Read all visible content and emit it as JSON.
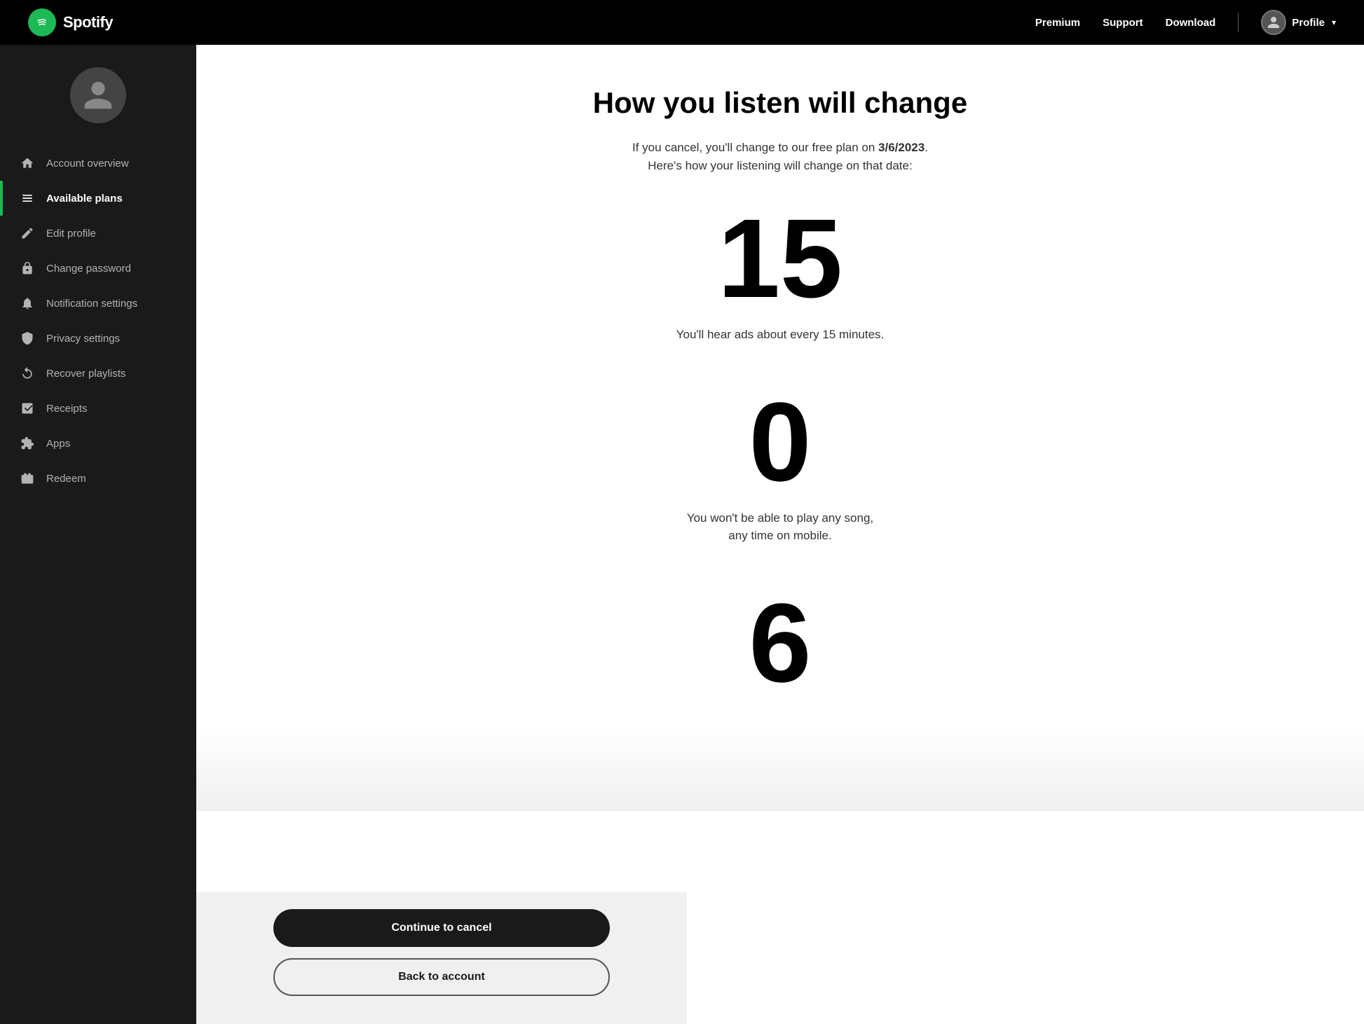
{
  "header": {
    "logo_text": "Spotify",
    "nav_items": [
      {
        "label": "Premium",
        "id": "premium"
      },
      {
        "label": "Support",
        "id": "support"
      },
      {
        "label": "Download",
        "id": "download"
      }
    ],
    "profile_label": "Profile"
  },
  "sidebar": {
    "items": [
      {
        "id": "account-overview",
        "label": "Account overview",
        "icon": "home-icon",
        "active": false
      },
      {
        "id": "available-plans",
        "label": "Available plans",
        "icon": "plans-icon",
        "active": true
      },
      {
        "id": "edit-profile",
        "label": "Edit profile",
        "icon": "edit-icon",
        "active": false
      },
      {
        "id": "change-password",
        "label": "Change password",
        "icon": "lock-icon",
        "active": false
      },
      {
        "id": "notification-settings",
        "label": "Notification settings",
        "icon": "bell-icon",
        "active": false
      },
      {
        "id": "privacy-settings",
        "label": "Privacy settings",
        "icon": "privacy-icon",
        "active": false
      },
      {
        "id": "recover-playlists",
        "label": "Recover playlists",
        "icon": "recover-icon",
        "active": false
      },
      {
        "id": "receipts",
        "label": "Receipts",
        "icon": "receipts-icon",
        "active": false
      },
      {
        "id": "apps",
        "label": "Apps",
        "icon": "apps-icon",
        "active": false
      },
      {
        "id": "redeem",
        "label": "Redeem",
        "icon": "redeem-icon",
        "active": false
      }
    ]
  },
  "main": {
    "title": "How you listen will change",
    "subtitle_text": "If you cancel, you'll change to our free plan on ",
    "subtitle_date": "3/6/2023",
    "subtitle_suffix": ".\nHere's how your listening will change on that date:",
    "stats": [
      {
        "number": "15",
        "description": "You'll hear ads about every 15 minutes."
      },
      {
        "number": "0",
        "description": "You won't be able to play any song,\nany time on mobile."
      },
      {
        "number": "6",
        "description": ""
      }
    ]
  },
  "buttons": {
    "continue_label": "Continue to cancel",
    "back_label": "Back to account"
  }
}
